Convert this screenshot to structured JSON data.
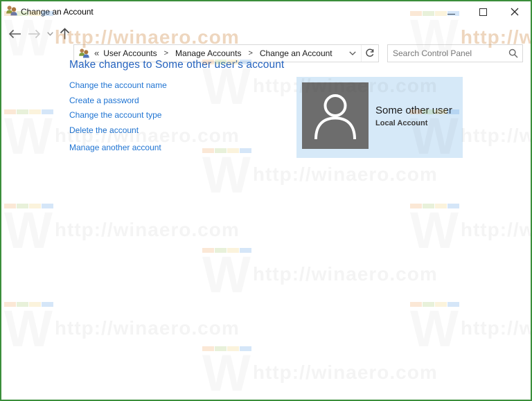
{
  "window": {
    "title": "Change an Account"
  },
  "nav": {
    "breadcrumb_root": "«",
    "separator": ">",
    "crumbs": [
      "User Accounts",
      "Manage Accounts",
      "Change an Account"
    ]
  },
  "search": {
    "placeholder": "Search Control Panel"
  },
  "main": {
    "heading": "Make changes to Some other user's account",
    "links": [
      "Change the account name",
      "Create a password",
      "Change the account type",
      "Delete the account"
    ],
    "manage_link": "Manage another account",
    "user_tile": {
      "name": "Some other user",
      "type": "Local Account"
    }
  },
  "watermark": {
    "letter": "W",
    "text": "http://winaero.com"
  },
  "icons": [
    "users-icon",
    "minimize-icon",
    "maximize-icon",
    "close-icon",
    "back-icon",
    "forward-icon",
    "history-chevron-icon",
    "up-icon",
    "chevron-down-icon",
    "refresh-icon",
    "search-icon",
    "person-icon"
  ],
  "colors": {
    "heading": "#2563bf",
    "link": "#1e73d2",
    "tile_bg": "#d6e9f8",
    "avatar_bg": "#6d6d6d",
    "screenshot_border": "#3a8e3a"
  }
}
